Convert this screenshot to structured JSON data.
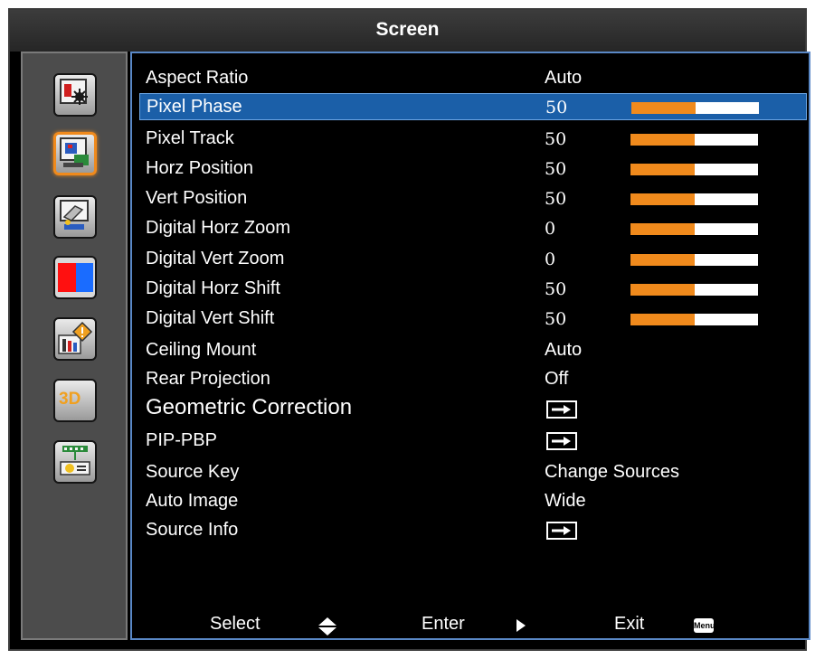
{
  "title": "Screen",
  "colors": {
    "accent": "#f08a1c",
    "selection": "#1b5fa8",
    "border": "#5a88c6"
  },
  "sidebar": {
    "items": [
      {
        "icon": "image-settings-icon",
        "active": false
      },
      {
        "icon": "screen-settings-icon",
        "active": true
      },
      {
        "icon": "setting-icon",
        "active": false
      },
      {
        "icon": "color-icon",
        "active": false
      },
      {
        "icon": "options-icon",
        "active": false
      },
      {
        "icon": "3d-icon",
        "active": false,
        "text": "3D"
      },
      {
        "icon": "network-icon",
        "active": false
      }
    ]
  },
  "menu": {
    "items": [
      {
        "label": "Aspect Ratio",
        "value": "Auto",
        "type": "text"
      },
      {
        "label": "Pixel Phase",
        "value": "50",
        "type": "slider",
        "level": 0.5,
        "selected": true
      },
      {
        "label": "Pixel Track",
        "value": "50",
        "type": "slider",
        "level": 0.5
      },
      {
        "label": "Horz Position",
        "value": "50",
        "type": "slider",
        "level": 0.5
      },
      {
        "label": "Vert Position",
        "value": "50",
        "type": "slider",
        "level": 0.5
      },
      {
        "label": "Digital Horz Zoom",
        "value": "0",
        "type": "slider",
        "level": 0.5
      },
      {
        "label": "Digital Vert Zoom",
        "value": "0",
        "type": "slider",
        "level": 0.5
      },
      {
        "label": "Digital Horz Shift",
        "value": "50",
        "type": "slider",
        "level": 0.5
      },
      {
        "label": "Digital Vert Shift",
        "value": "50",
        "type": "slider",
        "level": 0.5
      },
      {
        "label": "Ceiling Mount",
        "value": "Auto",
        "type": "text"
      },
      {
        "label": "Rear Projection",
        "value": "Off",
        "type": "text"
      },
      {
        "label": "Geometric Correction",
        "type": "submenu"
      },
      {
        "label": "PIP-PBP",
        "type": "submenu"
      },
      {
        "label": "Source Key",
        "value": "Change Sources",
        "type": "text"
      },
      {
        "label": "Auto Image",
        "value": "Wide",
        "type": "text"
      },
      {
        "label": "Source Info",
        "type": "submenu"
      }
    ]
  },
  "footer": {
    "select_label": "Select",
    "enter_label": "Enter",
    "exit_label": "Exit",
    "menu_key": "Menu"
  }
}
